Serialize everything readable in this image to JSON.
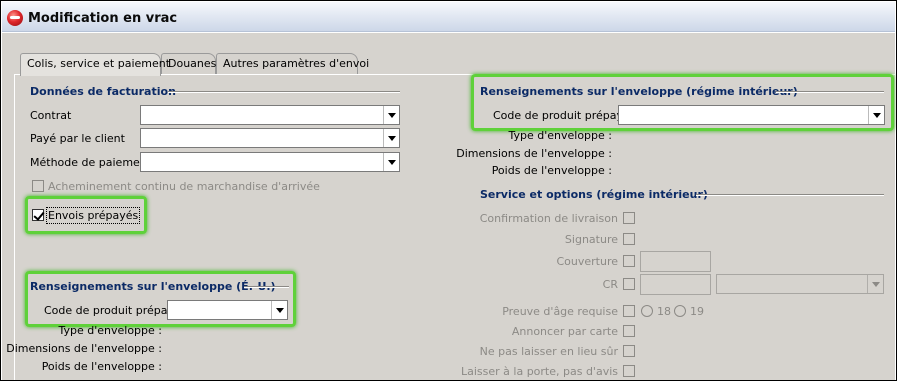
{
  "window": {
    "title": "Modification en vrac"
  },
  "tabs": [
    "Colis, service et paiement",
    "Douanes",
    "Autres paramètres d'envoi"
  ],
  "billing": {
    "title": "Données de facturation",
    "contract_label": "Contrat",
    "contract_value": "",
    "paid_by_label": "Payé par le client",
    "paid_by_value": "",
    "payment_method_label": "Méthode de paiement",
    "payment_method_value": "",
    "continuous_label": "Acheminement continu de marchandise d'arrivée",
    "continuous_checked": false,
    "prepaid_label": "Envois prépayés",
    "prepaid_checked": true
  },
  "envelope_us": {
    "title": "Renseignements sur l'enveloppe (É.-U.)",
    "code_label": "Code de produit prépayé",
    "code_value": "",
    "type_label": "Type d'enveloppe :",
    "dimensions_label": "Dimensions de l'enveloppe :",
    "weight_label": "Poids de l'enveloppe :"
  },
  "envelope_domestic": {
    "title": "Renseignements sur l'enveloppe (régime intérieur)",
    "code_label": "Code de produit prépayé",
    "code_value": "",
    "type_label": "Type d'enveloppe :",
    "dimensions_label": "Dimensions de l'enveloppe :",
    "weight_label": "Poids de l'enveloppe :"
  },
  "services": {
    "title": "Service et options (régime intérieur)",
    "delivery_confirmation": "Confirmation de livraison",
    "signature": "Signature",
    "coverage": "Couverture",
    "coverage_value": "",
    "cod": "CR",
    "cod_value": "",
    "cod_select": "",
    "age_proof": "Preuve d'âge requise",
    "age_option_18": "18",
    "age_option_19": "19",
    "card_for_pickup": "Annoncer par carte",
    "do_not_leave_safe": "Ne pas laisser en lieu sûr",
    "leave_at_door": "Laisser à la porte, pas d'avis"
  },
  "colors": {
    "highlight": "#5fd13a",
    "section_title": "#0b2a66",
    "panel": "#d6d3ce"
  }
}
